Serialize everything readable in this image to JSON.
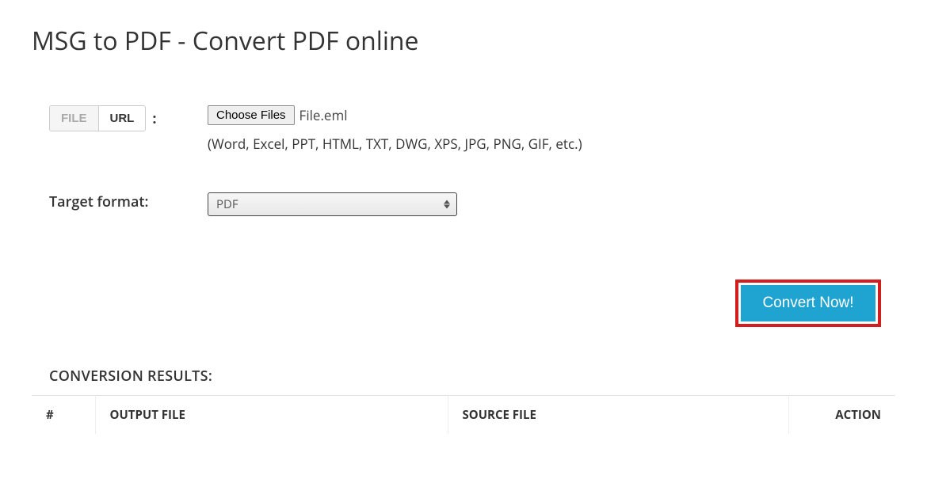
{
  "page": {
    "title": "MSG to PDF - Convert PDF online"
  },
  "source": {
    "tabs": {
      "file": "FILE",
      "url": "URL"
    },
    "colon": ":",
    "choose_label": "Choose Files",
    "file_name": "File.eml",
    "hint": "(Word, Excel, PPT, HTML, TXT, DWG, XPS, JPG, PNG, GIF, etc.)"
  },
  "target": {
    "label": "Target format:",
    "value": "PDF"
  },
  "buttons": {
    "convert": "Convert Now!"
  },
  "results": {
    "heading": "CONVERSION RESULTS:",
    "columns": {
      "num": "#",
      "output": "OUTPUT FILE",
      "source": "SOURCE FILE",
      "action": "ACTION"
    }
  }
}
